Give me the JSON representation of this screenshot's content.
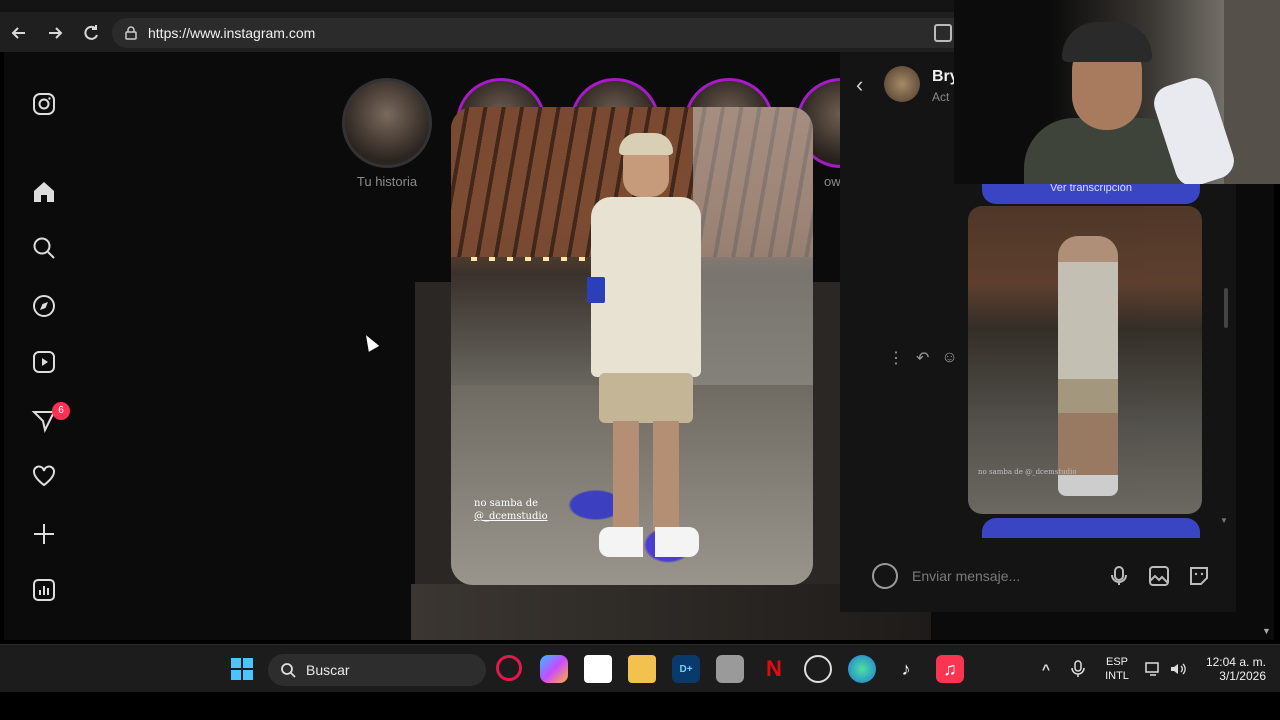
{
  "browser": {
    "url": "https://www.instagram.com",
    "nav": [
      "back-icon",
      "forward-icon",
      "reload-icon",
      "lock-icon"
    ]
  },
  "sidebar": {
    "items": [
      {
        "icon": "instagram-logo-icon"
      },
      {
        "icon": "home-icon"
      },
      {
        "icon": "search-icon"
      },
      {
        "icon": "explore-compass-icon"
      },
      {
        "icon": "reels-icon"
      },
      {
        "icon": "messages-icon",
        "badge": "6"
      },
      {
        "icon": "heart-icon"
      },
      {
        "icon": "create-plus-icon"
      },
      {
        "icon": "dashboard-icon"
      }
    ]
  },
  "stories": [
    {
      "name": "Tu historia"
    },
    {
      "name": ""
    },
    {
      "name": ""
    },
    {
      "name": ""
    },
    {
      "name": "owe"
    }
  ],
  "overlay": {
    "caption_line1": "no samba de",
    "caption_handle": "@_dcemstudio"
  },
  "dm": {
    "name": "Bry",
    "status": "Act",
    "transcript": "Ver transcripción",
    "message_placeholder": "Enviar mensaje...",
    "mini_caption": "no samba de @_dcemstudio"
  },
  "taskbar": {
    "search_label": "Buscar",
    "lang_top": "ESP",
    "lang_bottom": "INTL",
    "time": "12:04 a. m.",
    "date": "3/1/2026"
  },
  "colors": {
    "accent_blue": "#3a45c4",
    "story_ring": "#a51bc7",
    "badge": "#ff2f55"
  }
}
